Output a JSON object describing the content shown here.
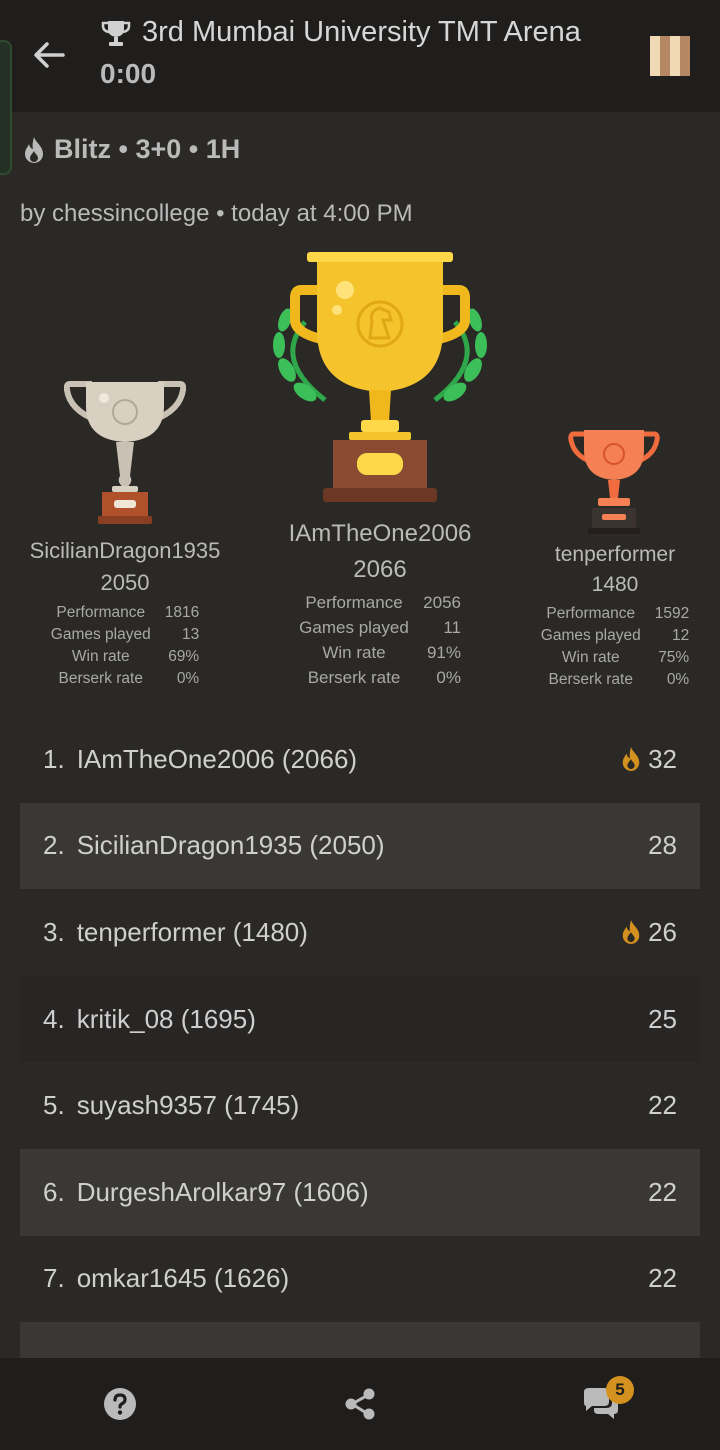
{
  "header": {
    "title": "3rd Mumbai University TMT Arena",
    "clock": "0:00",
    "back_icon": "arrow-left-icon",
    "board_icon": "chessboard-icon"
  },
  "tournament": {
    "format": "Blitz • 3+0 • 1H",
    "creator_line": "by chessincollege • today at 4:00 PM"
  },
  "podium": {
    "second": {
      "name": "SicilianDragon1935",
      "rating": "2050",
      "stats": [
        {
          "label": "Performance",
          "value": "1816"
        },
        {
          "label": "Games played",
          "value": "13"
        },
        {
          "label": "Win rate",
          "value": "69%"
        },
        {
          "label": "Berserk rate",
          "value": "0%"
        }
      ]
    },
    "first": {
      "name": "IAmTheOne2006",
      "rating": "2066",
      "stats": [
        {
          "label": "Performance",
          "value": "2056"
        },
        {
          "label": "Games played",
          "value": "11"
        },
        {
          "label": "Win rate",
          "value": "91%"
        },
        {
          "label": "Berserk rate",
          "value": "0%"
        }
      ]
    },
    "third": {
      "name": "tenperformer",
      "rating": "1480",
      "stats": [
        {
          "label": "Performance",
          "value": "1592"
        },
        {
          "label": "Games played",
          "value": "12"
        },
        {
          "label": "Win rate",
          "value": "75%"
        },
        {
          "label": "Berserk rate",
          "value": "0%"
        }
      ]
    }
  },
  "standings": [
    {
      "rank": "1.",
      "player": "IAmTheOne2006 (2066)",
      "score": "32",
      "streak": true
    },
    {
      "rank": "2.",
      "player": "SicilianDragon1935 (2050)",
      "score": "28",
      "streak": false
    },
    {
      "rank": "3.",
      "player": "tenperformer (1480)",
      "score": "26",
      "streak": true
    },
    {
      "rank": "4.",
      "player": "kritik_08 (1695)",
      "score": "25",
      "streak": false
    },
    {
      "rank": "5.",
      "player": "suyash9357 (1745)",
      "score": "22",
      "streak": false
    },
    {
      "rank": "6.",
      "player": "DurgeshArolkar97 (1606)",
      "score": "22",
      "streak": false
    },
    {
      "rank": "7.",
      "player": "omkar1645 (1626)",
      "score": "22",
      "streak": false
    }
  ],
  "bottom_bar": {
    "help_icon": "help-icon",
    "share_icon": "share-icon",
    "chat_icon": "chat-icon",
    "chat_badge": "5"
  },
  "colors": {
    "background": "#2b2926",
    "bar": "#1f1e1c",
    "gold": "#f5c42c",
    "silver": "#c9c2b4",
    "bronze": "#f06b3d",
    "streak_fire": "#d59120"
  }
}
